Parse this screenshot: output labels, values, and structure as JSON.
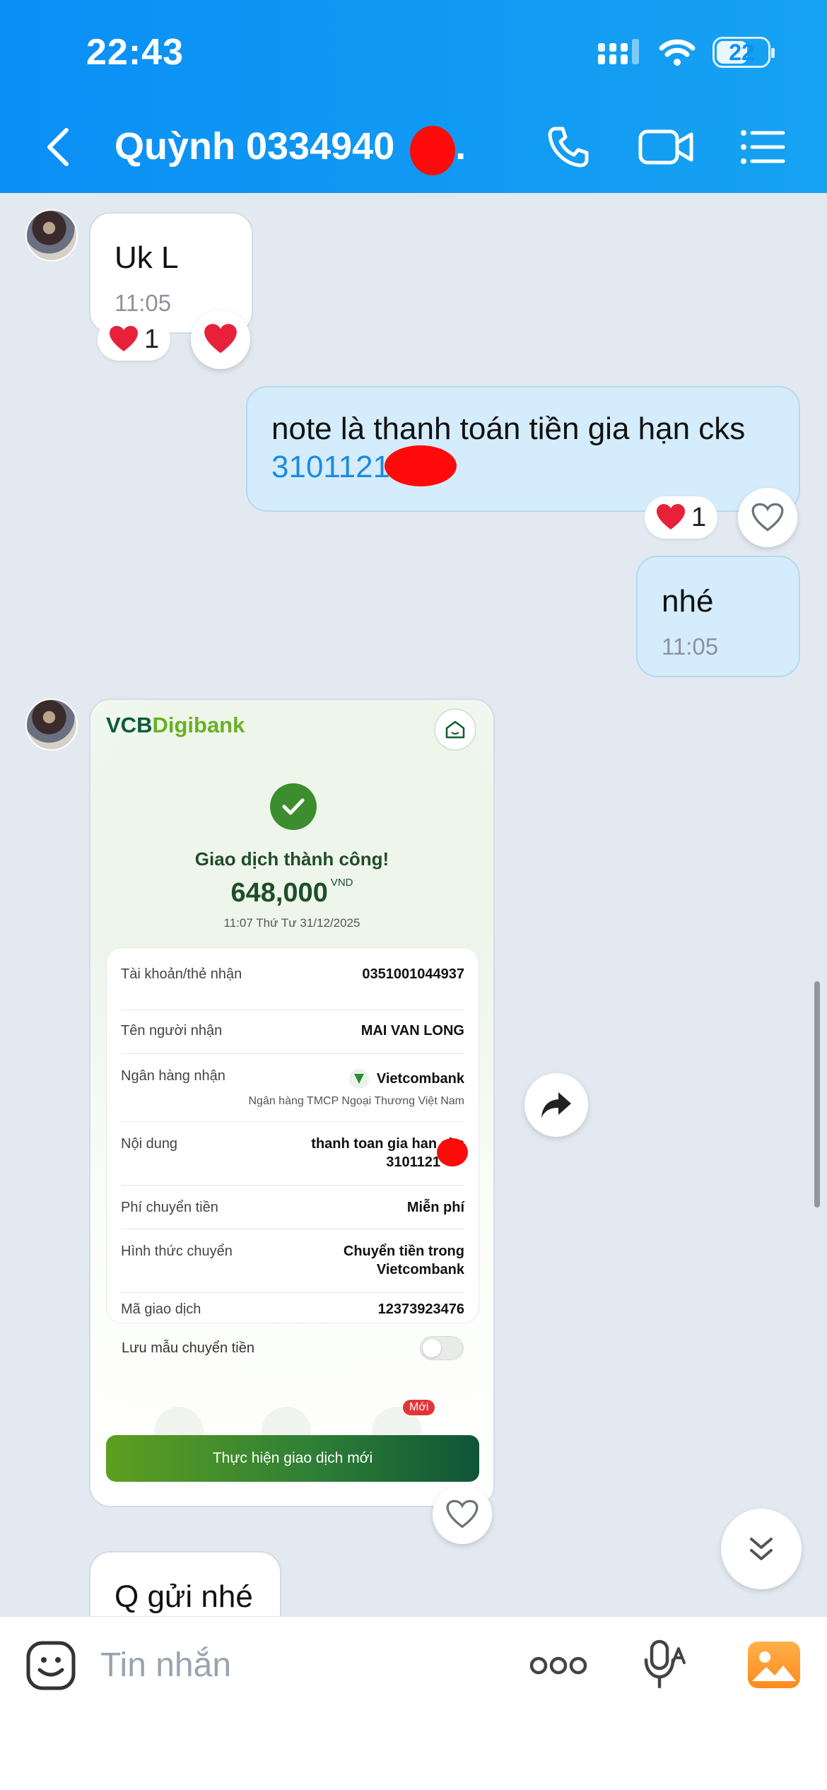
{
  "status_bar": {
    "time": "22:43",
    "battery": "22",
    "icons": [
      "cellular-signal-icon",
      "wifi-icon",
      "battery-icon"
    ]
  },
  "header": {
    "title": "Quỳnh 0334940",
    "title_suffix": "...",
    "icons": [
      "back-arrow-icon",
      "phone-icon",
      "video-call-icon",
      "menu-list-icon"
    ],
    "colors": {
      "background": "#0a8ff5",
      "text": "#ffffff"
    }
  },
  "messages": [
    {
      "side": "in",
      "text": "Uk L",
      "time": "11:05",
      "reaction_count": "1"
    },
    {
      "side": "out",
      "text": "note là thanh toán tiền gia hạn cks",
      "link": "3101121",
      "reaction_count": "1"
    },
    {
      "side": "out",
      "text": "nhé",
      "time": "11:05"
    },
    {
      "side": "in",
      "text": "Q gửi nhé"
    }
  ],
  "receipt": {
    "brand_a": "VCB",
    "brand_b": "Digibank",
    "status": "Giao dịch thành công!",
    "amount": "648,000",
    "currency": "VND",
    "datetime": "11:07 Thứ Tư 31/12/2025",
    "rows": [
      {
        "label": "Tài khoản/thẻ nhận",
        "value": "0351001044937"
      },
      {
        "label": "Tên người nhận",
        "value": "MAI VAN LONG"
      },
      {
        "label": "Ngân hàng nhận",
        "value": "Vietcombank",
        "sub": "Ngân hàng TMCP Ngoại Thương Việt Nam"
      },
      {
        "label": "Nội dung",
        "value": "thanh toan gia han cks",
        "value2": "3101121"
      },
      {
        "label": "Phí chuyển tiền",
        "value": "Miễn phí"
      },
      {
        "label": "Hình thức chuyển",
        "value": "Chuyển tiền trong",
        "value2": "Vietcombank"
      },
      {
        "label": "Mã giao dịch",
        "value": "12373923476"
      }
    ],
    "save_template": "Lưu mẫu chuyển tiền",
    "new_badge": "Mới",
    "new_transaction": "Thực hiện giao dịch mới"
  },
  "composer": {
    "placeholder": "Tin nhắn",
    "icons": [
      "sticker-icon",
      "more-options-icon",
      "voice-to-text-icon",
      "image-gallery-icon"
    ]
  }
}
